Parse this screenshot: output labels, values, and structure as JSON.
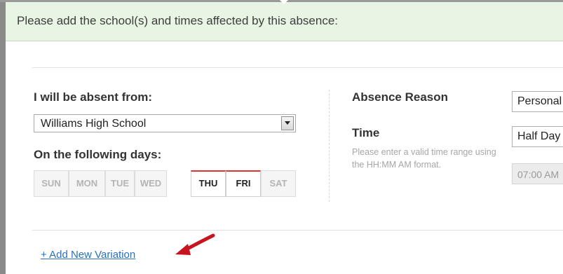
{
  "header": {
    "instruction": "Please add the school(s) and times affected by this absence:"
  },
  "absence": {
    "absent_from_label": "I will be absent from:",
    "school_selected": "Williams High School",
    "days_label": "On the following days:",
    "days": [
      {
        "label": "SUN",
        "selected": false
      },
      {
        "label": "MON",
        "selected": false
      },
      {
        "label": "TUE",
        "selected": false
      },
      {
        "label": "WED",
        "selected": false
      },
      {
        "label": "THU",
        "selected": true
      },
      {
        "label": "FRI",
        "selected": true
      },
      {
        "label": "SAT",
        "selected": false
      }
    ]
  },
  "details": {
    "reason_label": "Absence Reason",
    "reason_value": "Personal",
    "time_label": "Time",
    "time_value": "Half Day",
    "time_help": "Please enter a valid time range using the HH:MM AM format.",
    "start_time_value": "07:00 AM"
  },
  "footer": {
    "add_variation_link": "+ Add New Variation"
  },
  "colors": {
    "banner_bg": "#e9f5e4",
    "selected_day_accent": "#e03131",
    "link": "#2a6fb8",
    "arrow": "#c8141e"
  }
}
